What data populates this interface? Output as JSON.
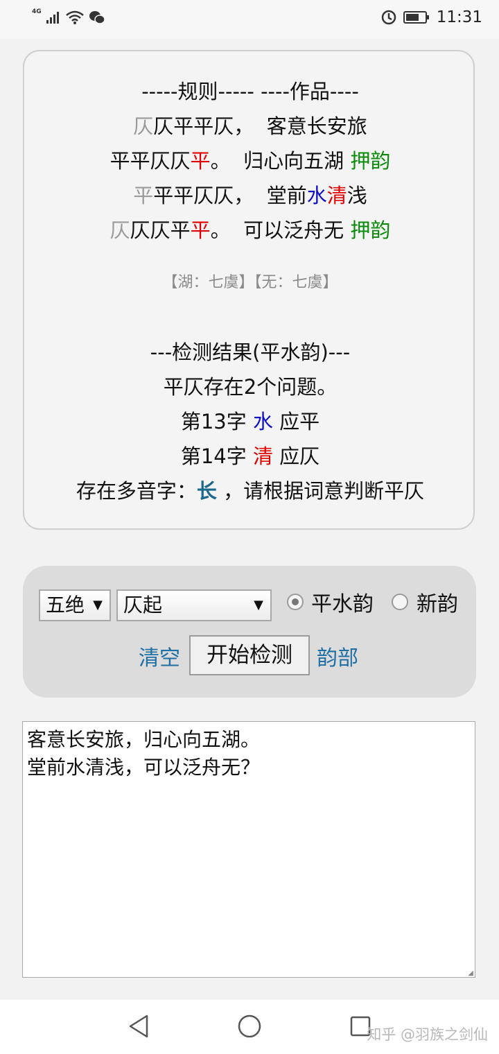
{
  "status_bar": {
    "network": "4G",
    "time": "11:31"
  },
  "result": {
    "header": "-----规则----- ----作品----",
    "rows": [
      {
        "rule_first": "仄",
        "rule_mid": "仄平平仄",
        "rule_last": "",
        "rule_punct": "，",
        "poem_pre": "客意长安旅",
        "poem_blue": "",
        "poem_red": "",
        "poem_post": "",
        "tag": ""
      },
      {
        "rule_first": "",
        "rule_mid": "平平仄仄",
        "rule_last": "平",
        "rule_punct": "。",
        "poem_pre": "归心向五湖",
        "poem_blue": "",
        "poem_red": "",
        "poem_post": "",
        "tag": "押韵"
      },
      {
        "rule_first": "平",
        "rule_mid": "平平仄仄",
        "rule_last": "",
        "rule_punct": "，",
        "poem_pre": "堂前",
        "poem_blue": "水",
        "poem_red": "清",
        "poem_post": "浅",
        "tag": ""
      },
      {
        "rule_first": "仄",
        "rule_mid": "仄仄平",
        "rule_last": "平",
        "rule_punct": "。",
        "poem_pre": "可以泛舟无",
        "poem_blue": "",
        "poem_red": "",
        "poem_post": "",
        "tag": "押韵"
      }
    ],
    "rhyme_note": "【湖：七虞】【无：七虞】",
    "detect_header": "---检测结果(平水韵)---",
    "problem_summary": "平仄存在2个问题。",
    "issues": [
      {
        "prefix": "第13字 ",
        "char": "水",
        "suffix": " 应平"
      },
      {
        "prefix": "第14字 ",
        "char": "清",
        "suffix": " 应仄"
      }
    ],
    "polyphone_prefix": "存在多音字：",
    "polyphone_char": "长",
    "polyphone_suffix": " ，请根据词意判断平仄"
  },
  "controls": {
    "form_select": "五绝",
    "start_select": "仄起",
    "radio_pingshui": "平水韵",
    "radio_xinyun": "新韵",
    "selected_rhyme": "平水韵",
    "clear_link": "清空",
    "start_button": "开始检测",
    "rhyme_link": "韵部"
  },
  "textarea": {
    "line1": "客意长安旅，归心向五湖。",
    "line2": "",
    "line3": "堂前水清浅，可以泛舟无？"
  },
  "watermark": "知乎 @羽族之剑仙"
}
